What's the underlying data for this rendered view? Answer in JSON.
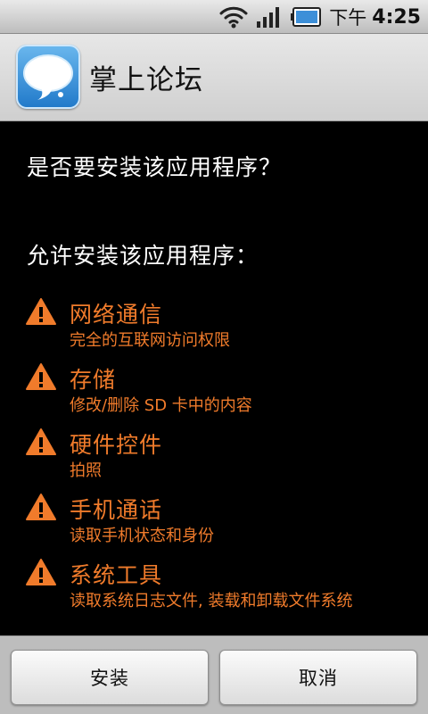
{
  "status_bar": {
    "ampm": "下午",
    "time": "4:25"
  },
  "header": {
    "app_name": "掌上论坛",
    "icon": "chat-bubble-icon"
  },
  "content": {
    "question": "是否要安装该应用程序？",
    "allow_heading": "允许安装该应用程序：",
    "permissions": [
      {
        "title": "网络通信",
        "desc": "完全的互联网访问权限"
      },
      {
        "title": "存储",
        "desc": "修改/删除 SD 卡中的内容"
      },
      {
        "title": "硬件控件",
        "desc": "拍照"
      },
      {
        "title": "手机通话",
        "desc": "读取手机状态和身份"
      },
      {
        "title": "系统工具",
        "desc": "读取系统日志文件, 装载和卸载文件系统"
      }
    ]
  },
  "buttons": {
    "install": "安装",
    "cancel": "取消"
  },
  "colors": {
    "warning": "#f07b2b",
    "background": "#000000"
  }
}
